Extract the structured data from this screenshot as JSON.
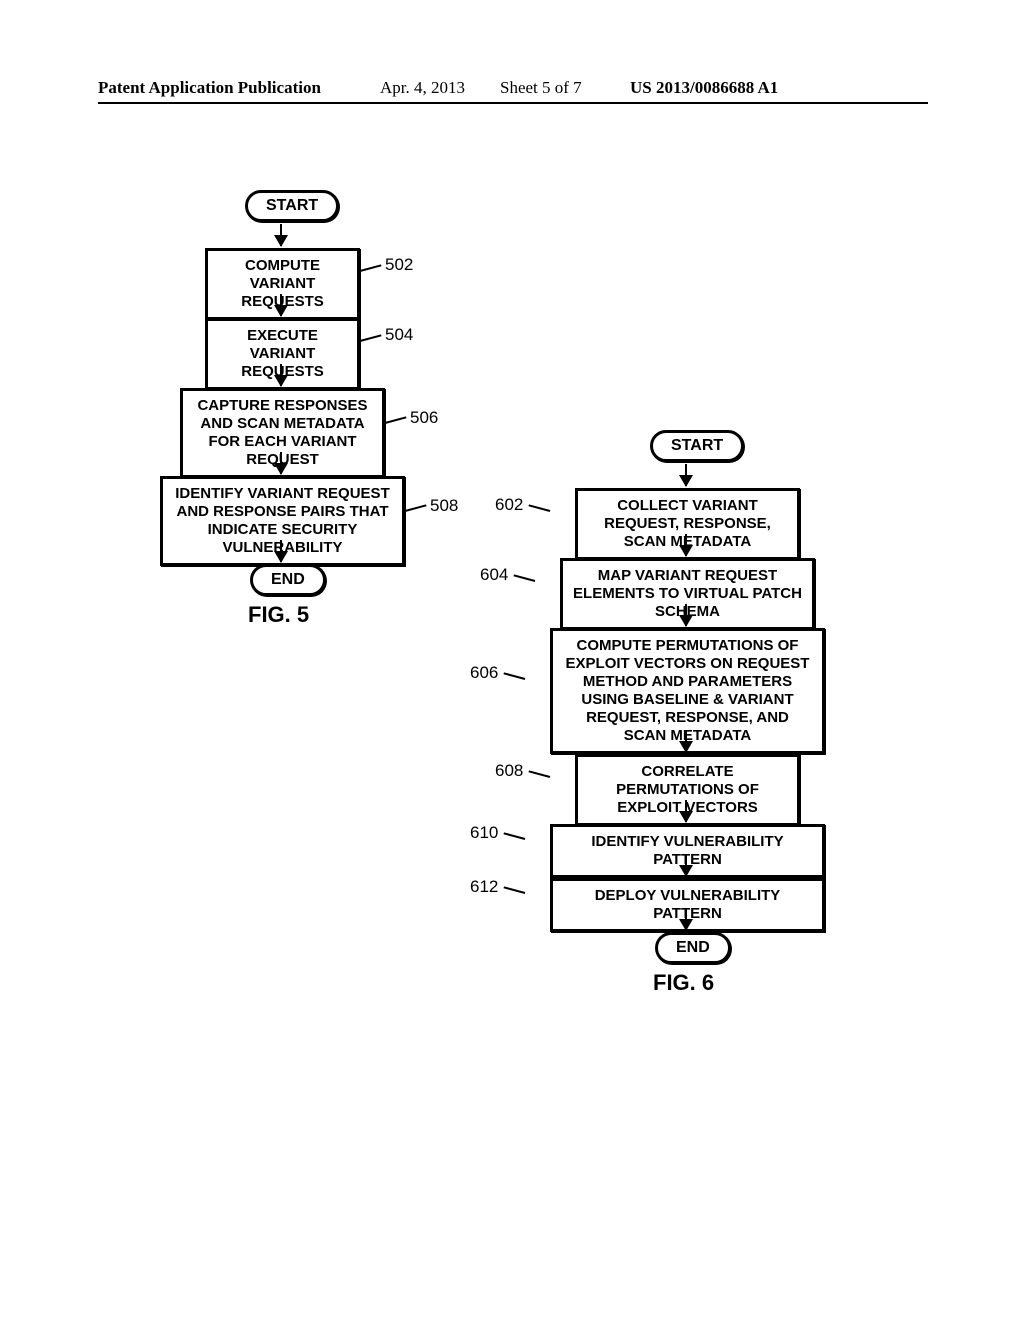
{
  "header": {
    "pub_label": "Patent Application Publication",
    "pub_date": "Apr. 4, 2013",
    "pub_sheet": "Sheet 5 of 7",
    "pub_num": "US 2013/0086688 A1"
  },
  "fig5": {
    "start": "START",
    "step_502": "COMPUTE VARIANT REQUESTS",
    "ref_502": "502",
    "step_504": "EXECUTE VARIANT REQUESTS",
    "ref_504": "504",
    "step_506": "CAPTURE RESPONSES AND SCAN METADATA FOR EACH VARIANT REQUEST",
    "ref_506": "506",
    "step_508": "IDENTIFY VARIANT REQUEST AND RESPONSE PAIRS THAT INDICATE SECURITY VULNERABILITY",
    "ref_508": "508",
    "end": "END",
    "caption": "FIG. 5"
  },
  "fig6": {
    "start": "START",
    "step_602": "COLLECT VARIANT REQUEST, RESPONSE, SCAN METADATA",
    "ref_602": "602",
    "step_604": "MAP VARIANT REQUEST ELEMENTS TO VIRTUAL PATCH SCHEMA",
    "ref_604": "604",
    "step_606": "COMPUTE PERMUTATIONS OF EXPLOIT VECTORS ON REQUEST METHOD AND PARAMETERS USING BASELINE & VARIANT REQUEST, RESPONSE, AND SCAN METADATA",
    "ref_606": "606",
    "step_608": "CORRELATE PERMUTATIONS OF EXPLOIT VECTORS",
    "ref_608": "608",
    "step_610": "IDENTIFY VULNERABILITY PATTERN",
    "ref_610": "610",
    "step_612": "DEPLOY VULNERABILITY PATTERN",
    "ref_612": "612",
    "end": "END",
    "caption": "FIG. 6"
  }
}
